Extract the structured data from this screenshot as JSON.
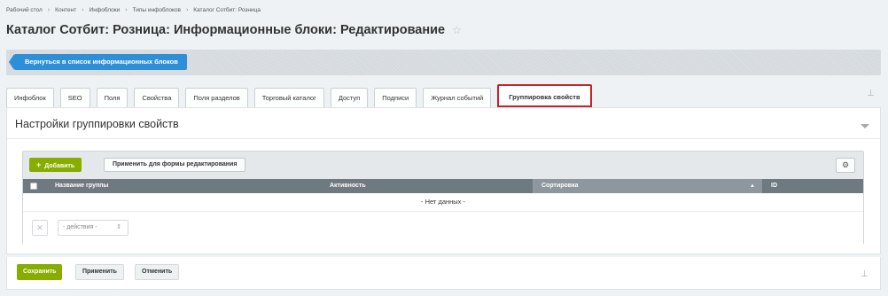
{
  "breadcrumb": {
    "items": [
      "Рабочий стол",
      "Контент",
      "Инфоблоки",
      "Типы инфоблоков",
      "Каталог Сотбит: Розница"
    ],
    "separator": "›"
  },
  "page": {
    "title": "Каталог Сотбит: Розница: Информационные блоки: Редактирование",
    "star_icon": "star-icon"
  },
  "back_bar": {
    "back_label": "Вернуться в список информационных блоков"
  },
  "tabs": [
    {
      "label": "Инфоблок"
    },
    {
      "label": "SEO"
    },
    {
      "label": "Поля"
    },
    {
      "label": "Свойства"
    },
    {
      "label": "Поля разделов"
    },
    {
      "label": "Торговый каталог"
    },
    {
      "label": "Доступ"
    },
    {
      "label": "Подписи"
    },
    {
      "label": "Журнал событий"
    },
    {
      "label": "Группировка свойств",
      "active": true
    }
  ],
  "panel": {
    "title": "Настройки группировки свойств"
  },
  "grid": {
    "add_label": "Добавить",
    "apply_form_label": "Применить для формы редактирования",
    "columns": [
      "Название группы",
      "Активность",
      "Сортировка",
      "ID"
    ],
    "sort_arrow": "▲",
    "empty_text": "- Нет данных -",
    "remove_glyph": "✕",
    "actions_placeholder": "- действия -",
    "actions_arrows": "⇕"
  },
  "footer": {
    "save_label": "Сохранить",
    "apply_label": "Применить",
    "cancel_label": "Отменить"
  },
  "colors": {
    "accent_blue": "#2d8fd8",
    "accent_green": "#86ad00",
    "active_tab_border": "#c8232c",
    "grid_header": "#6f7a80"
  }
}
